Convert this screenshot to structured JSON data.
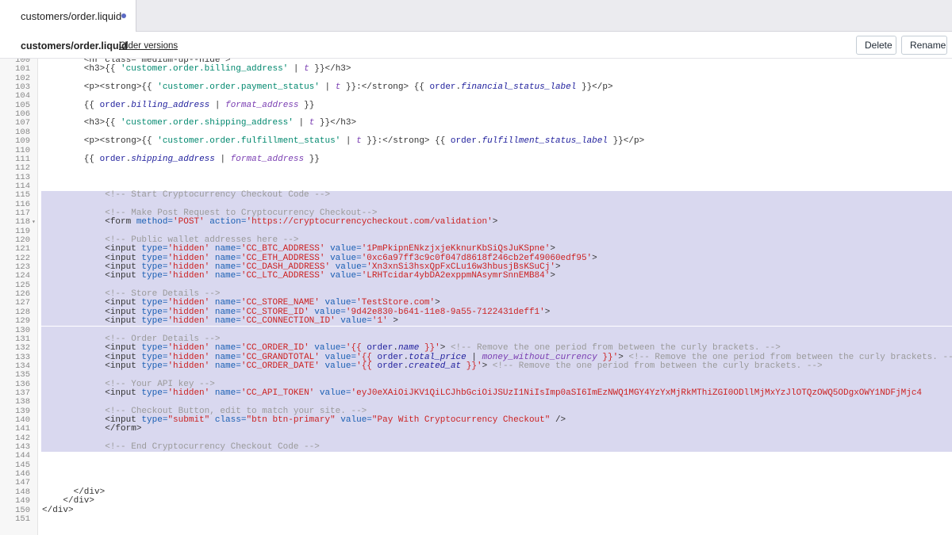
{
  "tab": {
    "label": "customers/order.liquid"
  },
  "header": {
    "file_title": "customers/order.liquid",
    "older_versions": "Older versions",
    "delete_label": "Delete",
    "rename_label": "Rename"
  },
  "editor": {
    "lines": [
      {
        "n": "100",
        "tokens": [
          {
            "t": "        <hr class=\"medium-up--hide\">",
            "c": "tag"
          }
        ]
      },
      {
        "n": "101",
        "tokens": [
          {
            "t": "        <h3>{{ ",
            "c": "tag"
          },
          {
            "t": "'customer.order.billing_address'",
            "c": "lq"
          },
          {
            "t": " | ",
            "c": "tag"
          },
          {
            "t": "t",
            "c": "filt"
          },
          {
            "t": " }}</h3>",
            "c": "tag"
          }
        ]
      },
      {
        "n": "102",
        "tokens": []
      },
      {
        "n": "103",
        "tokens": [
          {
            "t": "        <p><strong>{{ ",
            "c": "tag"
          },
          {
            "t": "'customer.order.payment_status'",
            "c": "lq"
          },
          {
            "t": " | ",
            "c": "tag"
          },
          {
            "t": "t",
            "c": "filt"
          },
          {
            "t": " }}:</strong> {{ ",
            "c": "tag"
          },
          {
            "t": "order",
            "c": "var"
          },
          {
            "t": ".",
            "c": "tag"
          },
          {
            "t": "financial_status_label",
            "c": "prop"
          },
          {
            "t": " }}</p>",
            "c": "tag"
          }
        ]
      },
      {
        "n": "104",
        "tokens": []
      },
      {
        "n": "105",
        "tokens": [
          {
            "t": "        {{ ",
            "c": "tag"
          },
          {
            "t": "order",
            "c": "var"
          },
          {
            "t": ".",
            "c": "tag"
          },
          {
            "t": "billing_address",
            "c": "prop"
          },
          {
            "t": " | ",
            "c": "tag"
          },
          {
            "t": "format_address",
            "c": "filt"
          },
          {
            "t": " }}",
            "c": "tag"
          }
        ]
      },
      {
        "n": "106",
        "tokens": []
      },
      {
        "n": "107",
        "tokens": [
          {
            "t": "        <h3>{{ ",
            "c": "tag"
          },
          {
            "t": "'customer.order.shipping_address'",
            "c": "lq"
          },
          {
            "t": " | ",
            "c": "tag"
          },
          {
            "t": "t",
            "c": "filt"
          },
          {
            "t": " }}</h3>",
            "c": "tag"
          }
        ]
      },
      {
        "n": "108",
        "tokens": []
      },
      {
        "n": "109",
        "tokens": [
          {
            "t": "        <p><strong>{{ ",
            "c": "tag"
          },
          {
            "t": "'customer.order.fulfillment_status'",
            "c": "lq"
          },
          {
            "t": " | ",
            "c": "tag"
          },
          {
            "t": "t",
            "c": "filt"
          },
          {
            "t": " }}:</strong> {{ ",
            "c": "tag"
          },
          {
            "t": "order",
            "c": "var"
          },
          {
            "t": ".",
            "c": "tag"
          },
          {
            "t": "fulfillment_status_label",
            "c": "prop"
          },
          {
            "t": " }}</p>",
            "c": "tag"
          }
        ]
      },
      {
        "n": "110",
        "tokens": []
      },
      {
        "n": "111",
        "tokens": [
          {
            "t": "        {{ ",
            "c": "tag"
          },
          {
            "t": "order",
            "c": "var"
          },
          {
            "t": ".",
            "c": "tag"
          },
          {
            "t": "shipping_address",
            "c": "prop"
          },
          {
            "t": " | ",
            "c": "tag"
          },
          {
            "t": "format_address",
            "c": "filt"
          },
          {
            "t": " }}",
            "c": "tag"
          }
        ]
      },
      {
        "n": "112",
        "tokens": []
      },
      {
        "n": "113",
        "tokens": []
      },
      {
        "n": "114",
        "tokens": []
      },
      {
        "n": "115",
        "sel": true,
        "tokens": [
          {
            "t": "            <!-- Start Cryptocurrency Checkout Code -->",
            "c": "cmt"
          }
        ]
      },
      {
        "n": "116",
        "sel": true,
        "tokens": []
      },
      {
        "n": "117",
        "sel": true,
        "tokens": [
          {
            "t": "            <!-- Make Post Request to Cryptocurrency Checkout-->",
            "c": "cmt"
          }
        ]
      },
      {
        "n": "118",
        "sel": true,
        "fold": true,
        "tokens": [
          {
            "t": "            <form ",
            "c": "tag"
          },
          {
            "t": "method=",
            "c": "attr"
          },
          {
            "t": "'POST'",
            "c": "str"
          },
          {
            "t": " action=",
            "c": "attr"
          },
          {
            "t": "'https://cryptocurrencycheckout.com/validation'",
            "c": "str"
          },
          {
            "t": ">",
            "c": "tag"
          }
        ]
      },
      {
        "n": "119",
        "sel": true,
        "tokens": []
      },
      {
        "n": "120",
        "sel": true,
        "tokens": [
          {
            "t": "            <!-- Public wallet addresses here -->",
            "c": "cmt"
          }
        ]
      },
      {
        "n": "121",
        "sel": true,
        "tokens": [
          {
            "t": "            <input ",
            "c": "tag"
          },
          {
            "t": "type=",
            "c": "attr"
          },
          {
            "t": "'hidden'",
            "c": "str"
          },
          {
            "t": " name=",
            "c": "attr"
          },
          {
            "t": "'CC_BTC_ADDRESS'",
            "c": "str"
          },
          {
            "t": " value=",
            "c": "attr"
          },
          {
            "t": "'1PmPkipnENkzjxjeKknurKbSiQsJuKSpne'",
            "c": "str"
          },
          {
            "t": ">",
            "c": "tag"
          }
        ]
      },
      {
        "n": "122",
        "sel": true,
        "tokens": [
          {
            "t": "            <input ",
            "c": "tag"
          },
          {
            "t": "type=",
            "c": "attr"
          },
          {
            "t": "'hidden'",
            "c": "str"
          },
          {
            "t": " name=",
            "c": "attr"
          },
          {
            "t": "'CC_ETH_ADDRESS'",
            "c": "str"
          },
          {
            "t": " value=",
            "c": "attr"
          },
          {
            "t": "'0xc6a97ff3c9c0f047d8618f246cb2ef49060edf95'",
            "c": "str"
          },
          {
            "t": ">",
            "c": "tag"
          }
        ]
      },
      {
        "n": "123",
        "sel": true,
        "tokens": [
          {
            "t": "            <input ",
            "c": "tag"
          },
          {
            "t": "type=",
            "c": "attr"
          },
          {
            "t": "'hidden'",
            "c": "str"
          },
          {
            "t": " name=",
            "c": "attr"
          },
          {
            "t": "'CC_DASH_ADDRESS'",
            "c": "str"
          },
          {
            "t": " value=",
            "c": "attr"
          },
          {
            "t": "'Xn3xnSi3hsxQpFxCLu16w3hbusjBsKSuCj'",
            "c": "str"
          },
          {
            "t": ">",
            "c": "tag"
          }
        ]
      },
      {
        "n": "124",
        "sel": true,
        "tokens": [
          {
            "t": "            <input ",
            "c": "tag"
          },
          {
            "t": "type=",
            "c": "attr"
          },
          {
            "t": "'hidden'",
            "c": "str"
          },
          {
            "t": " name=",
            "c": "attr"
          },
          {
            "t": "'CC_LTC_ADDRESS'",
            "c": "str"
          },
          {
            "t": " value=",
            "c": "attr"
          },
          {
            "t": "'LRHTcidar4ybDA2exppmNAsymrSnnEMB84'",
            "c": "str"
          },
          {
            "t": ">",
            "c": "tag"
          }
        ]
      },
      {
        "n": "125",
        "sel": true,
        "tokens": []
      },
      {
        "n": "126",
        "sel": true,
        "tokens": [
          {
            "t": "            <!-- Store Details -->",
            "c": "cmt"
          }
        ]
      },
      {
        "n": "127",
        "sel": true,
        "tokens": [
          {
            "t": "            <input ",
            "c": "tag"
          },
          {
            "t": "type=",
            "c": "attr"
          },
          {
            "t": "'hidden'",
            "c": "str"
          },
          {
            "t": " name=",
            "c": "attr"
          },
          {
            "t": "'CC_STORE_NAME'",
            "c": "str"
          },
          {
            "t": " value=",
            "c": "attr"
          },
          {
            "t": "'TestStore.com'",
            "c": "str"
          },
          {
            "t": ">",
            "c": "tag"
          }
        ]
      },
      {
        "n": "128",
        "sel": true,
        "tokens": [
          {
            "t": "            <input ",
            "c": "tag"
          },
          {
            "t": "type=",
            "c": "attr"
          },
          {
            "t": "'hidden'",
            "c": "str"
          },
          {
            "t": " name=",
            "c": "attr"
          },
          {
            "t": "'CC_STORE_ID'",
            "c": "str"
          },
          {
            "t": " value=",
            "c": "attr"
          },
          {
            "t": "'9d42e830-b641-11e8-9a55-7122431deff1'",
            "c": "str"
          },
          {
            "t": ">",
            "c": "tag"
          }
        ]
      },
      {
        "n": "129",
        "sel": true,
        "tokens": [
          {
            "t": "            <input ",
            "c": "tag"
          },
          {
            "t": "type=",
            "c": "attr"
          },
          {
            "t": "'hidden'",
            "c": "str"
          },
          {
            "t": " name=",
            "c": "attr"
          },
          {
            "t": "'CC_CONNECTION_ID'",
            "c": "str"
          },
          {
            "t": " value=",
            "c": "attr"
          },
          {
            "t": "'1'",
            "c": "str"
          },
          {
            "t": " >",
            "c": "tag"
          }
        ]
      },
      {
        "n": "130",
        "sel": true,
        "tokens": []
      },
      {
        "n": "131",
        "sel": true,
        "tokens": [
          {
            "t": "            <!-- Order Details -->",
            "c": "cmt"
          }
        ]
      },
      {
        "n": "132",
        "sel": true,
        "tokens": [
          {
            "t": "            <input ",
            "c": "tag"
          },
          {
            "t": "type=",
            "c": "attr"
          },
          {
            "t": "'hidden'",
            "c": "str"
          },
          {
            "t": " name=",
            "c": "attr"
          },
          {
            "t": "'CC_ORDER_ID'",
            "c": "str"
          },
          {
            "t": " value=",
            "c": "attr"
          },
          {
            "t": "'{{ ",
            "c": "str"
          },
          {
            "t": "order",
            "c": "var"
          },
          {
            "t": ".",
            "c": "tag"
          },
          {
            "t": "name",
            "c": "prop"
          },
          {
            "t": " }}'",
            "c": "str"
          },
          {
            "t": "> ",
            "c": "tag"
          },
          {
            "t": "<!-- Remove the one period from between the curly brackets. -->",
            "c": "cmt"
          }
        ]
      },
      {
        "n": "133",
        "sel": true,
        "tokens": [
          {
            "t": "            <input ",
            "c": "tag"
          },
          {
            "t": "type=",
            "c": "attr"
          },
          {
            "t": "'hidden'",
            "c": "str"
          },
          {
            "t": " name=",
            "c": "attr"
          },
          {
            "t": "'CC_GRANDTOTAL'",
            "c": "str"
          },
          {
            "t": " value=",
            "c": "attr"
          },
          {
            "t": "'{{ ",
            "c": "str"
          },
          {
            "t": "order",
            "c": "var"
          },
          {
            "t": ".",
            "c": "tag"
          },
          {
            "t": "total_price",
            "c": "prop"
          },
          {
            "t": " | ",
            "c": "tag"
          },
          {
            "t": "money_without_currency",
            "c": "filt"
          },
          {
            "t": " }}'",
            "c": "str"
          },
          {
            "t": "> ",
            "c": "tag"
          },
          {
            "t": "<!-- Remove the one period from between the curly brackets. -->",
            "c": "cmt"
          }
        ]
      },
      {
        "n": "134",
        "sel": true,
        "tokens": [
          {
            "t": "            <input ",
            "c": "tag"
          },
          {
            "t": "type=",
            "c": "attr"
          },
          {
            "t": "'hidden'",
            "c": "str"
          },
          {
            "t": " name=",
            "c": "attr"
          },
          {
            "t": "'CC_ORDER_DATE'",
            "c": "str"
          },
          {
            "t": " value=",
            "c": "attr"
          },
          {
            "t": "'{{ ",
            "c": "str"
          },
          {
            "t": "order",
            "c": "var"
          },
          {
            "t": ".",
            "c": "tag"
          },
          {
            "t": "created_at",
            "c": "prop"
          },
          {
            "t": " }}'",
            "c": "str"
          },
          {
            "t": "> ",
            "c": "tag"
          },
          {
            "t": "<!-- Remove the one period from between the curly brackets. -->",
            "c": "cmt"
          }
        ]
      },
      {
        "n": "135",
        "sel": true,
        "tokens": []
      },
      {
        "n": "136",
        "sel": true,
        "tokens": [
          {
            "t": "            <!-- Your API key -->",
            "c": "cmt"
          }
        ]
      },
      {
        "n": "137",
        "sel": true,
        "tokens": [
          {
            "t": "            <input ",
            "c": "tag"
          },
          {
            "t": "type=",
            "c": "attr"
          },
          {
            "t": "'hidden'",
            "c": "str"
          },
          {
            "t": " name=",
            "c": "attr"
          },
          {
            "t": "'CC_API_TOKEN'",
            "c": "str"
          },
          {
            "t": " value=",
            "c": "attr"
          },
          {
            "t": "'eyJ0eXAiOiJKV1QiLCJhbGciOiJSUzI1NiIsImp0aSI6ImEzNWQ1MGY4YzYxMjRkMThiZGI0ODllMjMxYzJlOTQzOWQ5ODgxOWY1NDFjMjc4",
            "c": "str"
          }
        ]
      },
      {
        "n": "138",
        "sel": true,
        "tokens": []
      },
      {
        "n": "139",
        "sel": true,
        "tokens": [
          {
            "t": "            <!-- Checkout Button, edit to match your site. -->",
            "c": "cmt"
          }
        ]
      },
      {
        "n": "140",
        "sel": true,
        "tokens": [
          {
            "t": "            <input ",
            "c": "tag"
          },
          {
            "t": "type=",
            "c": "attr"
          },
          {
            "t": "\"submit\"",
            "c": "str"
          },
          {
            "t": " class=",
            "c": "attr"
          },
          {
            "t": "\"btn btn-primary\"",
            "c": "str"
          },
          {
            "t": " value=",
            "c": "attr"
          },
          {
            "t": "\"Pay With Cryptocurrency Checkout\"",
            "c": "str"
          },
          {
            "t": " />",
            "c": "tag"
          }
        ]
      },
      {
        "n": "141",
        "sel": true,
        "tokens": [
          {
            "t": "            </form>",
            "c": "tag"
          }
        ]
      },
      {
        "n": "142",
        "sel": true,
        "tokens": []
      },
      {
        "n": "143",
        "sel": true,
        "tokens": [
          {
            "t": "            <!-- End Cryptocurrency Checkout Code -->",
            "c": "cmt"
          }
        ]
      },
      {
        "n": "144",
        "tokens": []
      },
      {
        "n": "145",
        "tokens": []
      },
      {
        "n": "146",
        "tokens": []
      },
      {
        "n": "147",
        "tokens": []
      },
      {
        "n": "148",
        "tokens": [
          {
            "t": "      </div>",
            "c": "tag"
          }
        ]
      },
      {
        "n": "149",
        "tokens": [
          {
            "t": "    </div>",
            "c": "tag"
          }
        ]
      },
      {
        "n": "150",
        "tokens": [
          {
            "t": "</div>",
            "c": "tag"
          }
        ]
      },
      {
        "n": "151",
        "tokens": []
      }
    ]
  }
}
